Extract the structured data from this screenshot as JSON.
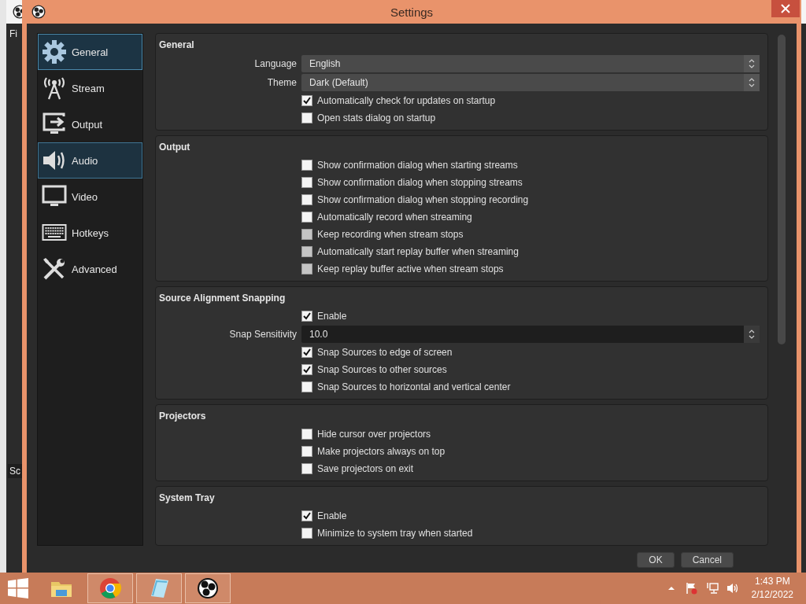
{
  "background_window": {
    "menu_text": "Fi",
    "dock_text": "Sc"
  },
  "window": {
    "title": "Settings"
  },
  "sidebar": {
    "items": [
      {
        "label": "General",
        "selected": true,
        "hovered": false
      },
      {
        "label": "Stream",
        "selected": false,
        "hovered": false
      },
      {
        "label": "Output",
        "selected": false,
        "hovered": false
      },
      {
        "label": "Audio",
        "selected": false,
        "hovered": true
      },
      {
        "label": "Video",
        "selected": false,
        "hovered": false
      },
      {
        "label": "Hotkeys",
        "selected": false,
        "hovered": false
      },
      {
        "label": "Advanced",
        "selected": false,
        "hovered": false
      }
    ]
  },
  "groups": [
    {
      "title": "General",
      "rows": [
        {
          "kind": "combo",
          "label": "Language",
          "value": "English"
        },
        {
          "kind": "combo",
          "label": "Theme",
          "value": "Dark (Default)"
        },
        {
          "kind": "checkbox",
          "label": "Automatically check for updates on startup",
          "checked": true,
          "disabled": false
        },
        {
          "kind": "checkbox",
          "label": "Open stats dialog on startup",
          "checked": false,
          "disabled": false
        }
      ]
    },
    {
      "title": "Output",
      "rows": [
        {
          "kind": "checkbox",
          "label": "Show confirmation dialog when starting streams",
          "checked": false,
          "disabled": false
        },
        {
          "kind": "checkbox",
          "label": "Show confirmation dialog when stopping streams",
          "checked": false,
          "disabled": false
        },
        {
          "kind": "checkbox",
          "label": "Show confirmation dialog when stopping recording",
          "checked": false,
          "disabled": false
        },
        {
          "kind": "checkbox",
          "label": "Automatically record when streaming",
          "checked": false,
          "disabled": false
        },
        {
          "kind": "checkbox",
          "label": "Keep recording when stream stops",
          "checked": false,
          "disabled": true
        },
        {
          "kind": "checkbox",
          "label": "Automatically start replay buffer when streaming",
          "checked": false,
          "disabled": true
        },
        {
          "kind": "checkbox",
          "label": "Keep replay buffer active when stream stops",
          "checked": false,
          "disabled": true
        }
      ]
    },
    {
      "title": "Source Alignment Snapping",
      "rows": [
        {
          "kind": "checkbox",
          "label": "Enable",
          "checked": true,
          "disabled": false
        },
        {
          "kind": "spin",
          "label": "Snap Sensitivity",
          "value": "10.0"
        },
        {
          "kind": "checkbox",
          "label": "Snap Sources to edge of screen",
          "checked": true,
          "disabled": false
        },
        {
          "kind": "checkbox",
          "label": "Snap Sources to other sources",
          "checked": true,
          "disabled": false
        },
        {
          "kind": "checkbox",
          "label": "Snap Sources to horizontal and vertical center",
          "checked": false,
          "disabled": false
        }
      ]
    },
    {
      "title": "Projectors",
      "rows": [
        {
          "kind": "checkbox",
          "label": "Hide cursor over projectors",
          "checked": false,
          "disabled": false
        },
        {
          "kind": "checkbox",
          "label": "Make projectors always on top",
          "checked": false,
          "disabled": false
        },
        {
          "kind": "checkbox",
          "label": "Save projectors on exit",
          "checked": false,
          "disabled": false
        }
      ]
    },
    {
      "title": "System Tray",
      "rows": [
        {
          "kind": "checkbox",
          "label": "Enable",
          "checked": true,
          "disabled": false
        },
        {
          "kind": "checkbox",
          "label": "Minimize to system tray when started",
          "checked": false,
          "disabled": false
        }
      ]
    }
  ],
  "buttons": [
    "OK",
    "Cancel"
  ],
  "taskbar": {
    "apps": [
      {
        "open": false
      },
      {
        "open": true
      },
      {
        "open": true
      },
      {
        "open": true
      }
    ],
    "time": "1:43 PM",
    "date": "2/12/2022"
  }
}
